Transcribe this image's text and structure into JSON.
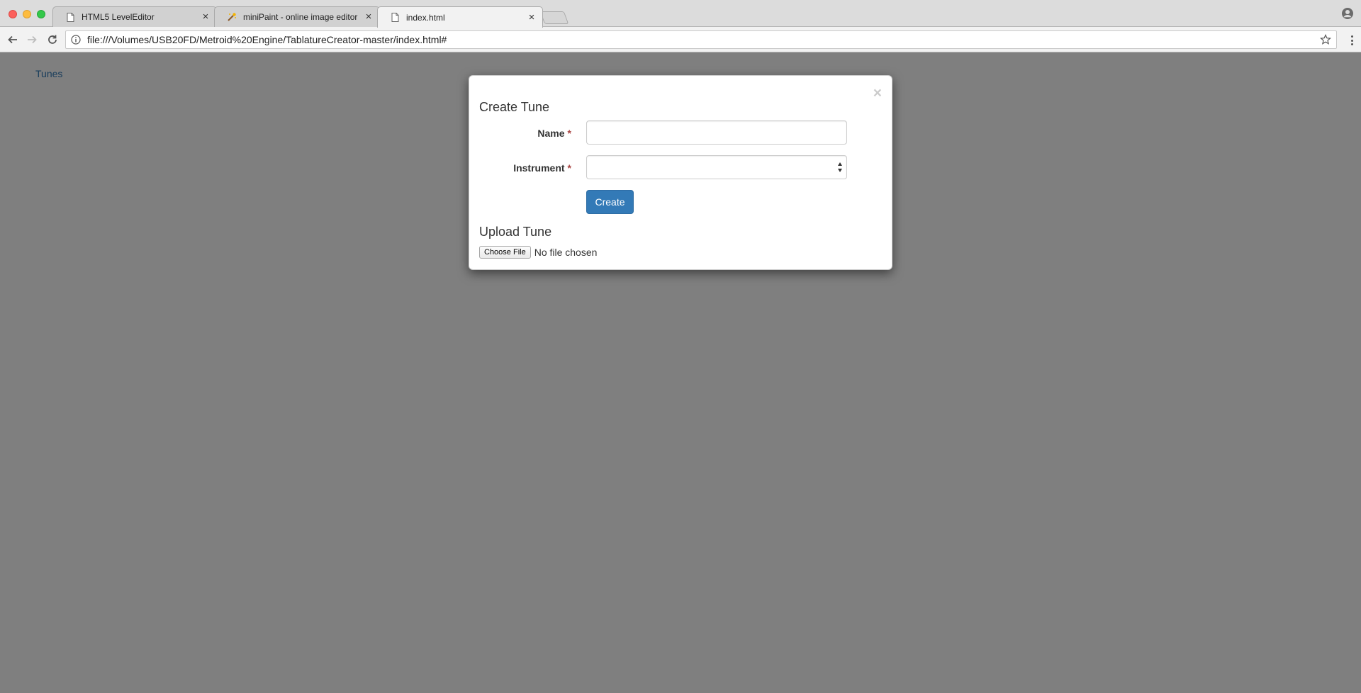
{
  "browser": {
    "tabs": [
      {
        "title": "HTML5 LevelEditor",
        "icon": "page-icon",
        "active": false
      },
      {
        "title": "miniPaint - online image editor",
        "icon": "minipaint-icon",
        "active": false
      },
      {
        "title": "index.html",
        "icon": "page-icon",
        "active": true
      }
    ],
    "address": "file:///Volumes/USB20FD/Metroid%20Engine/TablatureCreator-master/index.html#"
  },
  "page": {
    "nav_link": "Tunes"
  },
  "modal": {
    "close_label": "×",
    "create_heading": "Create Tune",
    "name_label": "Name",
    "instrument_label": "Instrument",
    "required_marker": "*",
    "name_value": "",
    "instrument_value": "",
    "create_button": "Create",
    "upload_heading": "Upload Tune",
    "choose_file_button": "Choose File",
    "file_status": "No file chosen"
  },
  "colors": {
    "primary": "#337ab7",
    "required": "#a94442",
    "backdrop": "#808080"
  }
}
